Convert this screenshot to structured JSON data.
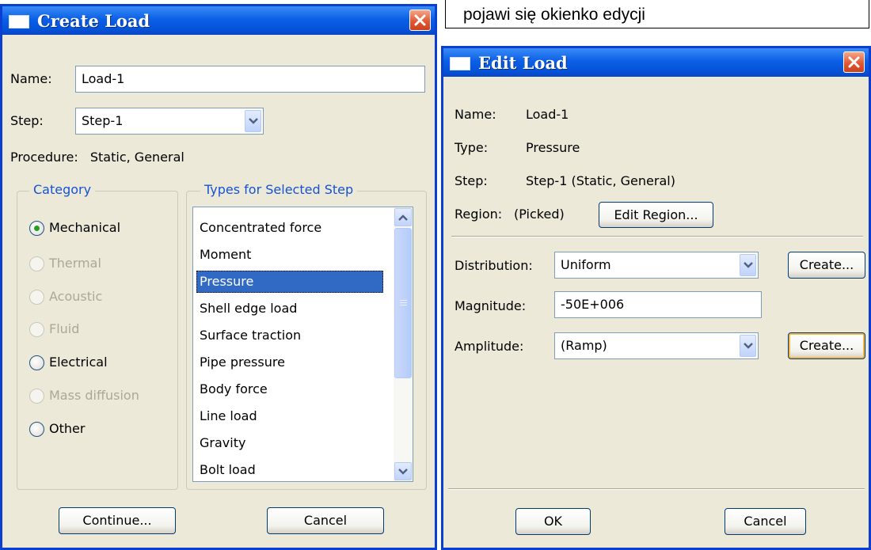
{
  "caption": "pojawi się okienko edycji",
  "create_load": {
    "title": "Create Load",
    "name_label": "Name:",
    "name_value": "Load-1",
    "step_label": "Step:",
    "step_value": "Step-1",
    "procedure_label": "Procedure:",
    "procedure_value": "Static, General",
    "category": {
      "title": "Category",
      "selected": "Mechanical",
      "options": [
        {
          "label": "Mechanical",
          "enabled": true,
          "checked": true
        },
        {
          "label": "Thermal",
          "enabled": false,
          "checked": false
        },
        {
          "label": "Acoustic",
          "enabled": false,
          "checked": false
        },
        {
          "label": "Fluid",
          "enabled": false,
          "checked": false
        },
        {
          "label": "Electrical",
          "enabled": true,
          "checked": false
        },
        {
          "label": "Mass diffusion",
          "enabled": false,
          "checked": false
        },
        {
          "label": "Other",
          "enabled": true,
          "checked": false
        }
      ]
    },
    "types": {
      "title": "Types for Selected Step",
      "selected": "Pressure",
      "items": [
        "Concentrated force",
        "Moment",
        "Pressure",
        "Shell edge load",
        "Surface traction",
        "Pipe pressure",
        "Body force",
        "Line load",
        "Gravity",
        "Bolt load"
      ]
    },
    "continue_label": "Continue...",
    "cancel_label": "Cancel"
  },
  "edit_load": {
    "title": "Edit Load",
    "name_label": "Name:",
    "name_value": "Load-1",
    "type_label": "Type:",
    "type_value": "Pressure",
    "step_label": "Step:",
    "step_value": "Step-1 (Static, General)",
    "region_label": "Region:",
    "region_value": "(Picked)",
    "edit_region_label": "Edit Region...",
    "distribution_label": "Distribution:",
    "distribution_value": "Uniform",
    "distribution_create_label": "Create...",
    "magnitude_label": "Magnitude:",
    "magnitude_value": "-50E+006",
    "amplitude_label": "Amplitude:",
    "amplitude_value": "(Ramp)",
    "amplitude_create_label": "Create...",
    "ok_label": "OK",
    "cancel_label": "Cancel"
  },
  "colors": {
    "titlebar": "#0553d9",
    "window_bg": "#ece9d8",
    "group_title": "#1553d4",
    "selection": "#316ac5",
    "close_button": "#e25a34"
  }
}
